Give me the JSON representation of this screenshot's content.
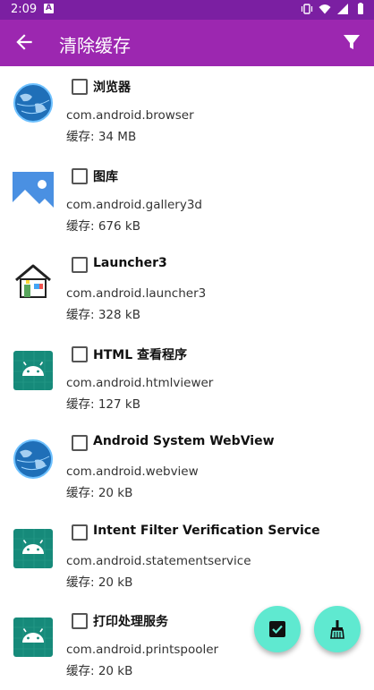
{
  "status_bar": {
    "time": "2:09",
    "notification_letter": "A"
  },
  "app_bar": {
    "title": "清除缓存",
    "back_icon": "arrow-back-icon",
    "filter_icon": "filter-icon"
  },
  "apps": [
    {
      "name": "浏览器",
      "package": "com.android.browser",
      "cache": "缓存: 34 MB",
      "icon": "globe-icon",
      "checked": false
    },
    {
      "name": "图库",
      "package": "com.android.gallery3d",
      "cache": "缓存: 676 kB",
      "icon": "gallery-icon",
      "checked": false
    },
    {
      "name": "Launcher3",
      "package": "com.android.launcher3",
      "cache": "缓存: 328 kB",
      "icon": "house-icon",
      "checked": false
    },
    {
      "name": "HTML 查看程序",
      "package": "com.android.htmlviewer",
      "cache": "缓存: 127 kB",
      "icon": "android-icon",
      "checked": false
    },
    {
      "name": "Android System WebView",
      "package": "com.android.webview",
      "cache": "缓存: 20 kB",
      "icon": "globe-icon",
      "checked": false
    },
    {
      "name": "Intent Filter Verification Service",
      "package": "com.android.statementservice",
      "cache": "缓存: 20 kB",
      "icon": "android-icon",
      "checked": false
    },
    {
      "name": "打印处理服务",
      "package": "com.android.printspooler",
      "cache": "缓存: 20 kB",
      "icon": "android-icon",
      "checked": false
    }
  ],
  "fabs": {
    "select_all_icon": "checkbox-checked-icon",
    "clean_icon": "broom-icon"
  },
  "colors": {
    "status_bar": "#7b1fa2",
    "app_bar": "#9c27b0",
    "fab": "#5fe9d0",
    "android_icon_bg": "#168a7a"
  }
}
